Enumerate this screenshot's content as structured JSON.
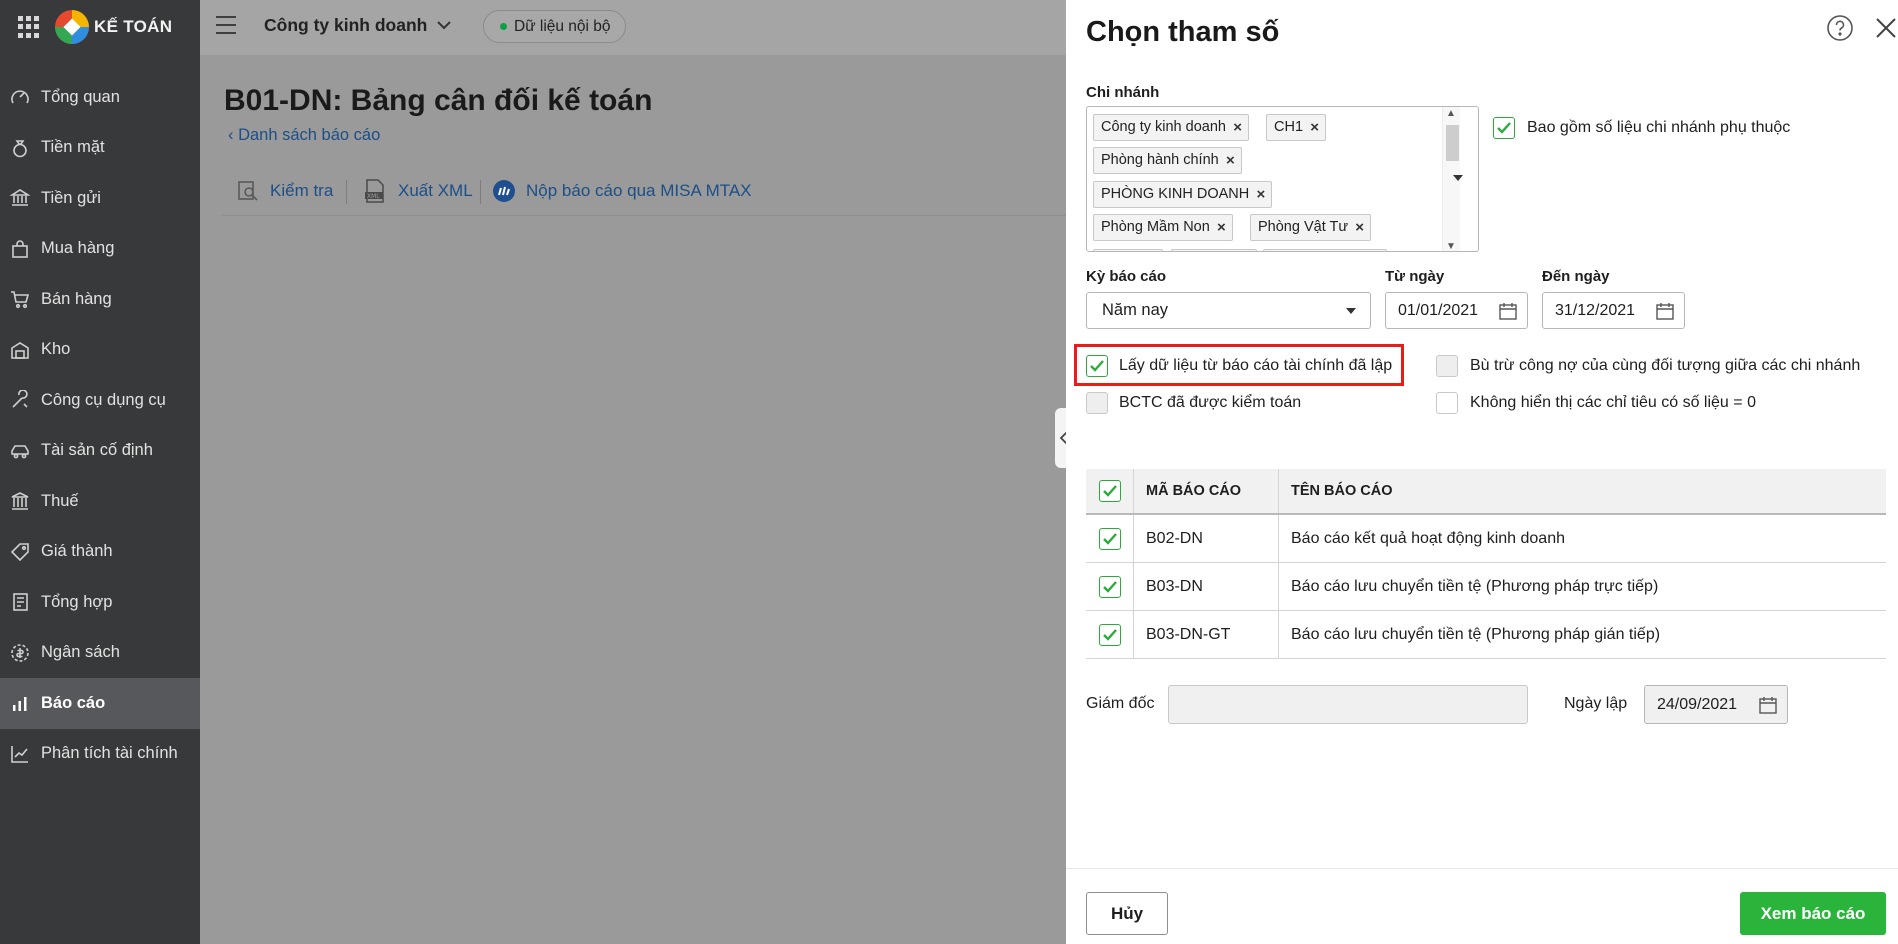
{
  "app": {
    "brand": "KẾ TOÁN"
  },
  "sidebar": {
    "items": [
      {
        "label": "Tổng quan",
        "icon": "gauge-icon"
      },
      {
        "label": "Tiền mặt",
        "icon": "money-bag-icon"
      },
      {
        "label": "Tiền gửi",
        "icon": "bank-icon"
      },
      {
        "label": "Mua hàng",
        "icon": "shopping-bag-icon"
      },
      {
        "label": "Bán hàng",
        "icon": "cart-icon"
      },
      {
        "label": "Kho",
        "icon": "warehouse-icon"
      },
      {
        "label": "Công cụ dụng cụ",
        "icon": "tools-icon"
      },
      {
        "label": "Tài sản cố định",
        "icon": "car-icon"
      },
      {
        "label": "Thuế",
        "icon": "tax-building-icon"
      },
      {
        "label": "Giá thành",
        "icon": "price-tag-icon"
      },
      {
        "label": "Tổng hợp",
        "icon": "ledger-icon"
      },
      {
        "label": "Ngân sách",
        "icon": "budget-icon"
      },
      {
        "label": "Báo cáo",
        "icon": "bar-chart-icon",
        "active": true
      },
      {
        "label": "Phân tích tài chính",
        "icon": "line-chart-icon"
      }
    ]
  },
  "topbar": {
    "company": "Công ty kinh doanh",
    "data_badge": "Dữ liệu nội bộ"
  },
  "main": {
    "title": "B01-DN: Bảng cân đối kế toán",
    "back_link": "Danh sách báo cáo",
    "toolbar": {
      "check": "Kiểm tra",
      "export_xml": "Xuất XML",
      "submit": "Nộp báo cáo qua MISA MTAX"
    }
  },
  "panel": {
    "title": "Chọn tham số",
    "branch_label": "Chi nhánh",
    "branches": [
      "Công ty kinh doanh",
      "CH1",
      "Phòng hành chính",
      "PHÒNG KINH DOANH",
      "Phòng Mầm Non",
      "Phòng Vật Tư"
    ],
    "include_sub_branches": {
      "label": "Bao gồm số liệu chi nhánh phụ thuộc",
      "checked": true
    },
    "period_label": "Kỳ báo cáo",
    "period_value": "Năm nay",
    "from_label": "Từ ngày",
    "from_value": "01/01/2021",
    "to_label": "Đến ngày",
    "to_value": "31/12/2021",
    "options": {
      "use_existing": {
        "label": "Lấy dữ liệu từ báo cáo tài chính đã lập",
        "checked": true
      },
      "offset_debt": {
        "label": "Bù trừ công nợ của cùng đối tượng giữa các chi nhánh",
        "checked": false
      },
      "audited": {
        "label": "BCTC đã được kiểm toán",
        "checked": false
      },
      "hide_zero": {
        "label": "Không hiển thị các chỉ tiêu có số liệu = 0",
        "checked": false
      }
    },
    "table": {
      "headers": [
        "MÃ BÁO CÁO",
        "TÊN BÁO CÁO"
      ],
      "rows": [
        {
          "code": "B02-DN",
          "name": "Báo cáo kết quả hoạt động kinh doanh",
          "checked": true
        },
        {
          "code": "B03-DN",
          "name": "Báo cáo lưu chuyển tiền tệ (Phương pháp trực tiếp)",
          "checked": true
        },
        {
          "code": "B03-DN-GT",
          "name": "Báo cáo lưu chuyển tiền tệ (Phương pháp gián tiếp)",
          "checked": true
        }
      ]
    },
    "director_label": "Giám đốc",
    "director_value": "",
    "created_label": "Ngày lập",
    "created_value": "24/09/2021",
    "cancel": "Hủy",
    "view_report": "Xem báo cáo"
  },
  "colors": {
    "sidebar_bg": "#38393b",
    "accent_green": "#2bb43c",
    "link_blue": "#1c4e88",
    "highlight_red": "#e91b1b"
  }
}
